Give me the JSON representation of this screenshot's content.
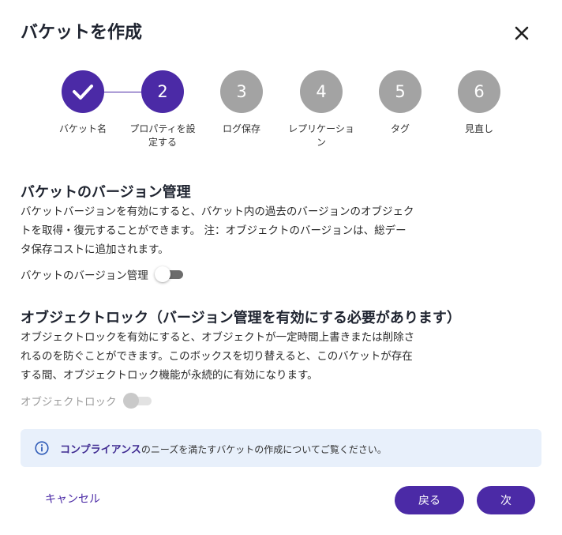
{
  "dialog": {
    "title": "バケットを作成",
    "close_icon": "close-icon"
  },
  "stepper": {
    "steps": [
      {
        "number": "",
        "label": "バケット名",
        "state": "done",
        "icon": "check-icon"
      },
      {
        "number": "2",
        "label": "プロパティを設定する",
        "state": "active"
      },
      {
        "number": "3",
        "label": "ログ保存",
        "state": "pending"
      },
      {
        "number": "4",
        "label": "レプリケーション",
        "state": "pending"
      },
      {
        "number": "5",
        "label": "タグ",
        "state": "pending"
      },
      {
        "number": "6",
        "label": "見直し",
        "state": "pending"
      }
    ]
  },
  "versioning": {
    "title": "バケットのバージョン管理",
    "description": "バケットバージョンを有効にすると、バケット内の過去のバージョンのオブジェクトを取得・復元することができます。 注：オブジェクトのバージョンは、総データ保存コストに追加されます。",
    "toggle_label": "バケットのバージョン管理",
    "enabled": false
  },
  "object_lock": {
    "title": "オブジェクトロック（バージョン管理を有効にする必要があります）",
    "description": "オブジェクトロックを有効にすると、オブジェクトが一定時間上書きまたは削除されるのを防ぐことができます。このボックスを切り替えると、このバケットが存在する間、オブジェクトロック機能が永続的に有効になります。",
    "toggle_label": "オブジェクトロック",
    "enabled": false,
    "disabled": true
  },
  "info": {
    "icon": "info-icon",
    "link_text": "コンプライアンス",
    "text": "のニーズを満たすバケットの作成についてご覧ください。"
  },
  "footer": {
    "cancel_label": "キャンセル",
    "back_label": "戻る",
    "next_label": "次"
  },
  "colors": {
    "accent": "#4b2aa6",
    "pending_step": "#a3a3a3",
    "info_background": "#e8f0fb"
  }
}
